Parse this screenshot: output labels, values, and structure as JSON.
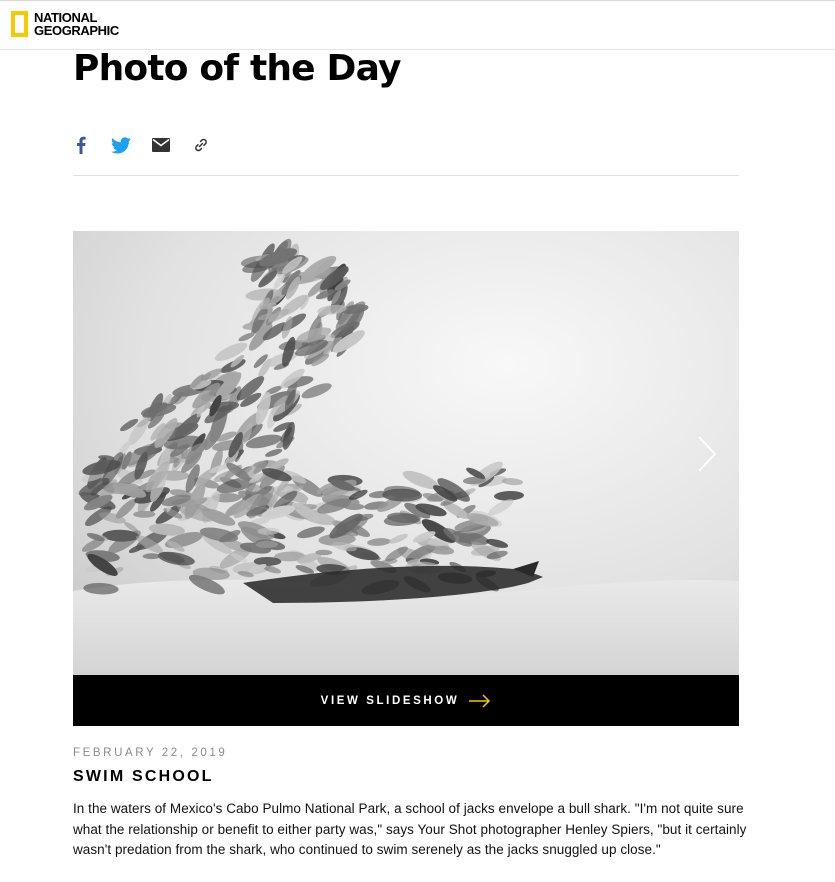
{
  "brand": {
    "logo_line1": "NATIONAL",
    "logo_line2": "GEOGRAPHIC",
    "accent": "#f6c900"
  },
  "page": {
    "title": "Photo of the Day"
  },
  "share": {
    "icons": [
      "facebook-icon",
      "twitter-icon",
      "email-icon",
      "link-icon"
    ],
    "colors": {
      "facebook": "#3b5998",
      "twitter": "#1da1f2",
      "email": "#333333",
      "link": "#333333"
    }
  },
  "photo": {
    "alt": "School of jacks enveloping a bull shark",
    "next_icon": "chevron-right-icon"
  },
  "slideshow": {
    "label": "VIEW SLIDESHOW",
    "arrow_color": "#f6c900"
  },
  "article": {
    "date": "FEBRUARY 22, 2019",
    "title": "SWIM SCHOOL",
    "caption": "In the waters of Mexico's Cabo Pulmo National Park, a school of jacks envelope a bull shark. \"I'm not quite sure what the relationship or benefit to either party was,\" says Your Shot photographer Henley Spiers, \"but it certainly wasn't predation from the shark, who continued to swim serenely as the jacks snuggled up close.\""
  }
}
